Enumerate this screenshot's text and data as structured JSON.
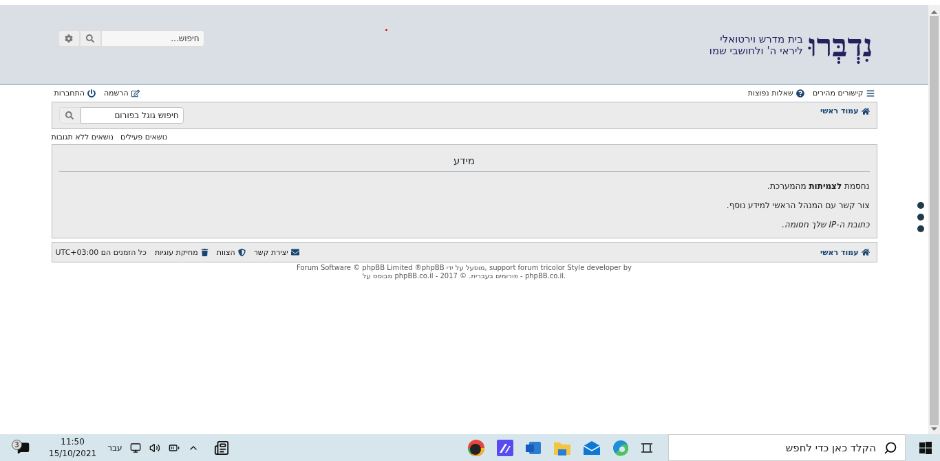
{
  "header": {
    "logo": "נִדְבְּרוּ",
    "tagline": [
      "בית מדרש וירטואלי",
      "ליראי ה' ולחושבי שמו"
    ],
    "search": {
      "placeholder": "חיפוש..."
    }
  },
  "nav": {
    "right": [
      {
        "kind": "menu",
        "label": "קישורים מהירים"
      },
      {
        "kind": "help",
        "label": "שאלות נפוצות"
      }
    ],
    "left": [
      {
        "kind": "register",
        "label": "הרשמה"
      },
      {
        "kind": "login",
        "label": "התחברות"
      }
    ]
  },
  "breadcrumb": {
    "label": "עמוד ראשי",
    "search": {
      "placeholder": "חיפוש גוגל בפורום"
    }
  },
  "quick_links": [
    "נושאים פעילים",
    "נושאים ללא תגובות"
  ],
  "panel": {
    "title": "מידע",
    "paragraphs": [
      {
        "kind": "text",
        "text": "נחסמת **לצמיתות** מהמערכת."
      },
      {
        "kind": "text",
        "text": "צור קשר עם המנהל הראשי למידע נוסף."
      },
      {
        "kind": "note",
        "text": "כתובת ה-IP שלך חסומה."
      }
    ]
  },
  "footer_nav": {
    "home": "עמוד ראשי",
    "links": [
      {
        "kind": "contact",
        "label": "יצירת קשר"
      },
      {
        "kind": "team",
        "label": "הצוות"
      },
      {
        "kind": "cookies",
        "label": "מחיקת עוגיות"
      }
    ],
    "timezone": "כל הזמנים הם UTC+03:00"
  },
  "credits": [
    "Forum Software © phpBB Limited ®phpBB מופעל על ידי, support forum tricolor Style developer by",
    "מבוסס על phpBB.co.il - פורומים בעברית. © 2017 - phpBB.co.il."
  ],
  "taskbar": {
    "search_placeholder": "הקלד כאן כדי לחפש",
    "notifications": "3",
    "time": "11:50",
    "date": "15/10/2021",
    "language": "עבר"
  }
}
